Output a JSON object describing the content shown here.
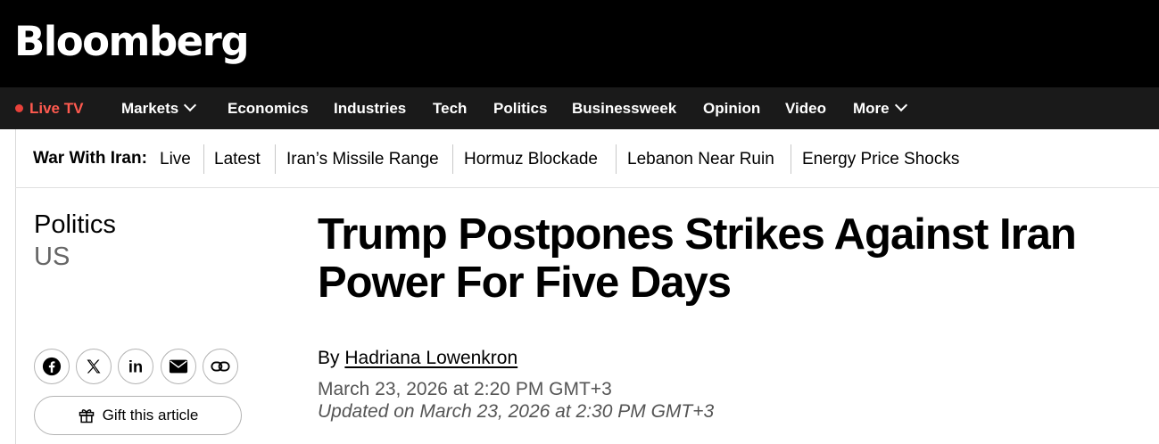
{
  "brand": {
    "logo_text": "Bloomberg"
  },
  "colors": {
    "live_accent": "#ff5a4f",
    "nav_bg": "#1a1a1a",
    "top_bg": "#000000"
  },
  "nav": {
    "live_tv": "Live TV",
    "items": [
      "Markets",
      "Economics",
      "Industries",
      "Tech",
      "Politics",
      "Businessweek",
      "Opinion",
      "Video",
      "More"
    ]
  },
  "subnav": {
    "title": "War With Iran:",
    "items": [
      "Live",
      "Latest",
      "Iran’s Missile Range",
      "Hormuz Blockade",
      "Lebanon Near Ruin",
      "Energy Price Shocks"
    ]
  },
  "article": {
    "section": "Politics",
    "subsection": "US",
    "headline": "Trump Postpones Strikes Against Iran Power For Five Days",
    "byline_prefix": "By",
    "author": "Hadriana Lowenkron",
    "published": "March 23, 2026 at 2:20 PM GMT+3",
    "updated": "Updated on March 23, 2026 at 2:30 PM GMT+3"
  },
  "share": {
    "icons": [
      "facebook-icon",
      "x-icon",
      "linkedin-icon",
      "email-icon",
      "link-icon"
    ],
    "gift_label": "Gift this article"
  }
}
